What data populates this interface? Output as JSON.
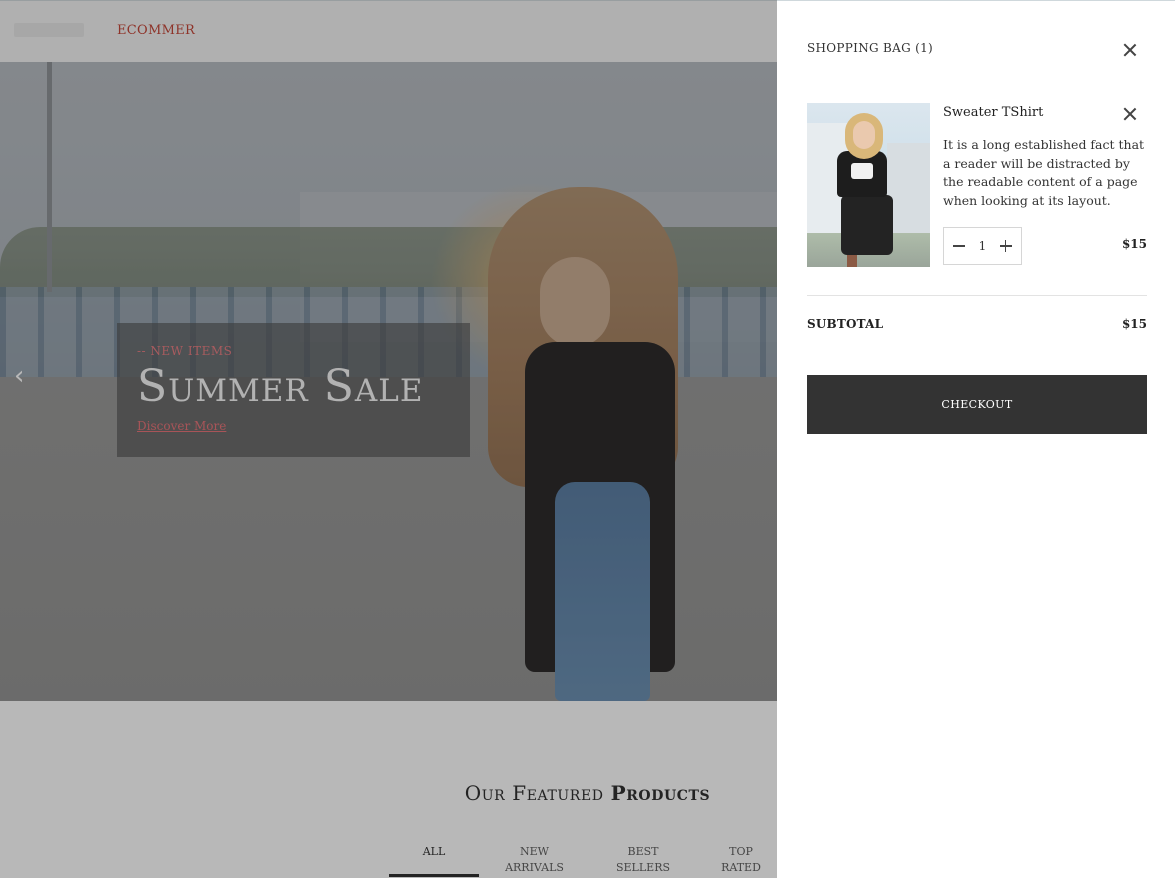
{
  "header": {
    "logo": "ECOMMER"
  },
  "hero": {
    "eyebrow": "-- NEW ITEMS",
    "title": "Summer Sale",
    "link": "Discover More",
    "prev_icon": "chevron-left-icon"
  },
  "featured": {
    "title_light": "Our Featured",
    "title_bold": "Products",
    "tabs": [
      {
        "label": "ALL",
        "active": true
      },
      {
        "label": "NEW ARRIVALS",
        "active": false
      },
      {
        "label": "BEST SELLERS",
        "active": false
      },
      {
        "label": "TOP RATED",
        "active": false
      }
    ]
  },
  "cart": {
    "title": "SHOPPING BAG (1)",
    "close_icon": "close-icon",
    "items": [
      {
        "name": "Sweater TShirt",
        "description": "It is a long established fact that a reader will be distracted by the readable content of a page when looking at its layout.",
        "quantity": "1",
        "price": "$15"
      }
    ],
    "subtotal_label": "SUBTOTAL",
    "subtotal_value": "$15",
    "checkout_label": "CHECKOUT"
  },
  "colors": {
    "accent": "#c0392b",
    "checkout_bg": "#333333"
  }
}
